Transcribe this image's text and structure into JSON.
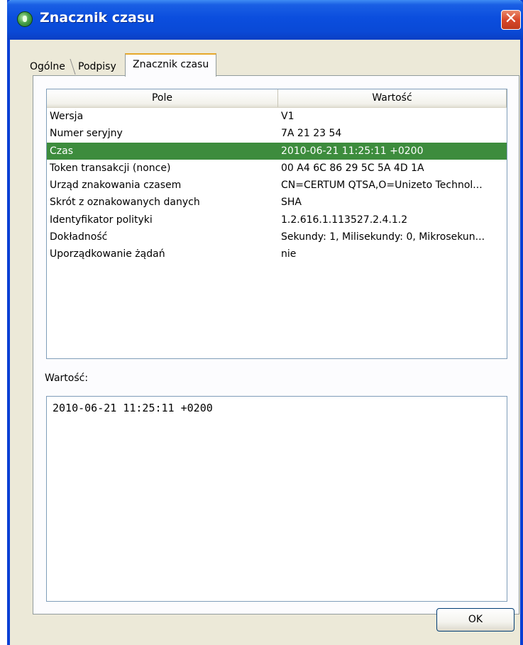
{
  "window": {
    "title": "Znacznik czasu",
    "close_glyph": "✕"
  },
  "tabs": [
    {
      "label": "Ogólne",
      "active": false
    },
    {
      "label": "Podpisy",
      "active": false
    },
    {
      "label": "Znacznik czasu",
      "active": true
    }
  ],
  "table": {
    "columns": [
      "Pole",
      "Wartość"
    ],
    "rows": [
      {
        "field": "Wersja",
        "value": "V1"
      },
      {
        "field": "Numer seryjny",
        "value": "7A 21 23 54"
      },
      {
        "field": "Czas",
        "value": "2010-06-21 11:25:11 +0200"
      },
      {
        "field": "Token transakcji (nonce)",
        "value": "00 A4 6C 86 29 5C 5A 4D 1A"
      },
      {
        "field": "Urząd znakowania czasem",
        "value": "CN=CERTUM QTSA,O=Unizeto Technol..."
      },
      {
        "field": "Skrót z oznakowanych danych",
        "value": "SHA"
      },
      {
        "field": "Identyfikator polityki",
        "value": "1.2.616.1.113527.2.4.1.2"
      },
      {
        "field": "Dokładność",
        "value": "Sekundy: 1, Milisekundy: 0, Mikrosekun..."
      },
      {
        "field": "Uporządkowanie żądań",
        "value": "nie"
      }
    ],
    "selected_row_index": 2
  },
  "value_section": {
    "label": "Wartość:",
    "content": "2010-06-21 11:25:11 +0200"
  },
  "buttons": {
    "ok_label": "OK"
  },
  "colors": {
    "selection": "#3d8c3d",
    "titlebar": "#0b4ede",
    "close_button": "#d8482a"
  }
}
